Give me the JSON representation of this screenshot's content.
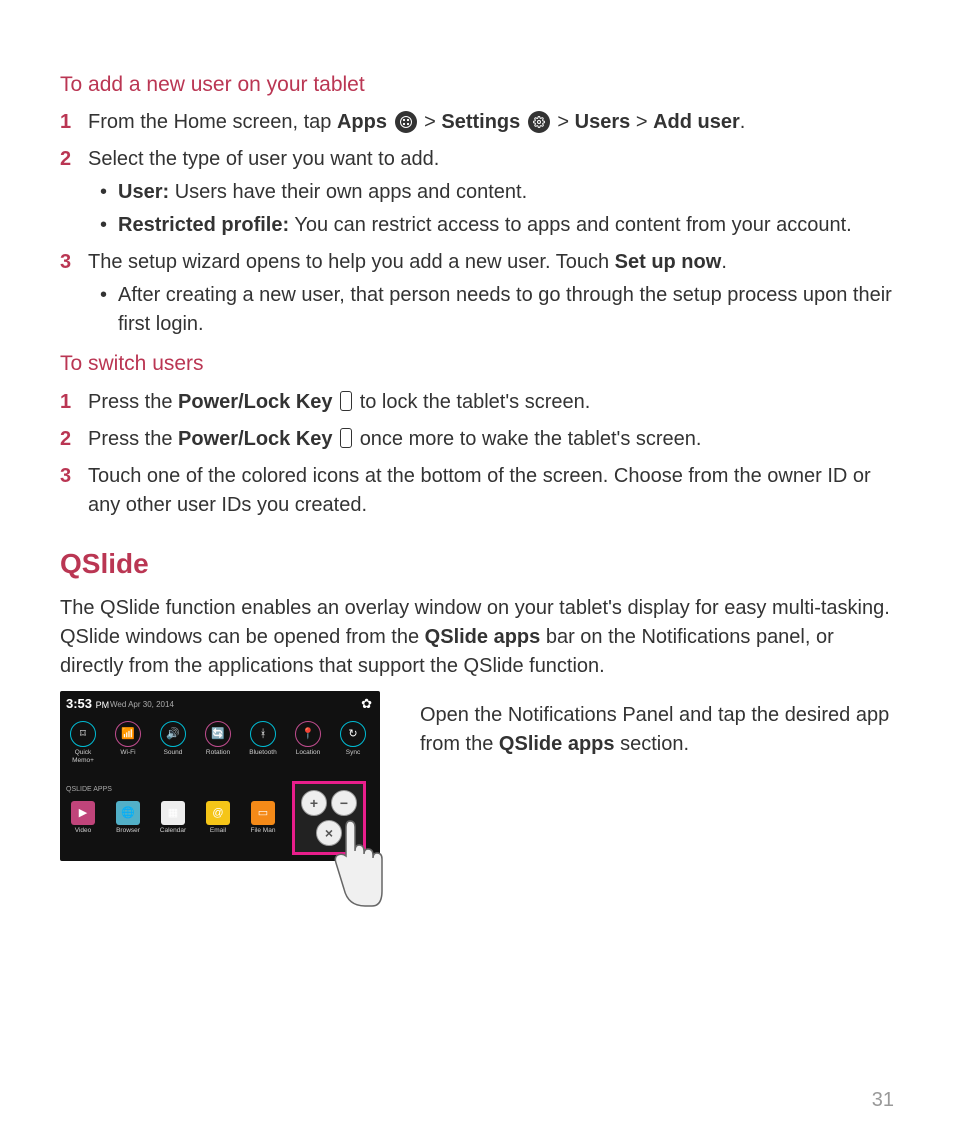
{
  "sections": {
    "add_user": {
      "title": "To add a new user on your tablet",
      "step1_pre": "From the Home screen, tap ",
      "step1_apps": "Apps",
      "step1_gt1": " > ",
      "step1_settings": "Settings",
      "step1_gt2": " > ",
      "step1_users": "Users",
      "step1_gt3": " > ",
      "step1_adduser": "Add user",
      "step1_dot": ".",
      "step2": "Select the type of user you want to add.",
      "step2_bullet1_label": "User:",
      "step2_bullet1_text": " Users have their own apps and content.",
      "step2_bullet2_label": "Restricted profile:",
      "step2_bullet2_text": " You can restrict access to apps and content from your account.",
      "step3_pre": "The setup wizard opens to help you add a new user. Touch ",
      "step3_bold": "Set up now",
      "step3_dot": ".",
      "step3_bullet": "After creating a new user, that person needs to go through the setup process upon their first login."
    },
    "switch_users": {
      "title": "To switch users",
      "step1_pre": "Press the ",
      "step1_bold": "Power/Lock Key",
      "step1_post": " to lock the tablet's screen.",
      "step2_pre": "Press the ",
      "step2_bold": "Power/Lock Key",
      "step2_post": " once more to wake the tablet's screen.",
      "step3": "Touch one of the colored icons at the bottom of the screen. Choose from the owner ID or any other user IDs you created."
    },
    "qslide": {
      "title": "QSlide",
      "intro_pre": "The QSlide function enables an overlay window on your tablet's display for easy multi-tasking. QSlide windows can be opened from the ",
      "intro_bold": "QSlide apps",
      "intro_post": " bar on the Notifications panel, or directly from the applications that support the QSlide function.",
      "side_pre": "Open the Notifications Panel and tap the desired app from the ",
      "side_bold": "QSlide apps",
      "side_post": " section."
    }
  },
  "screenshot": {
    "time": "3:53",
    "ampm": "PM",
    "date": "Wed Apr 30, 2014",
    "qslide_label": "QSLIDE APPS",
    "row1": [
      "Quick Memo+",
      "Wi-Fi",
      "Sound",
      "Rotation",
      "Bluetooth",
      "Location",
      "Sync"
    ],
    "row2": [
      "Video",
      "Browser",
      "Calendar",
      "Email",
      "File Man"
    ],
    "highlight_buttons": [
      "+",
      "−",
      "×"
    ]
  },
  "nums": {
    "n1": "1",
    "n2": "2",
    "n3": "3"
  },
  "page_number": "31"
}
